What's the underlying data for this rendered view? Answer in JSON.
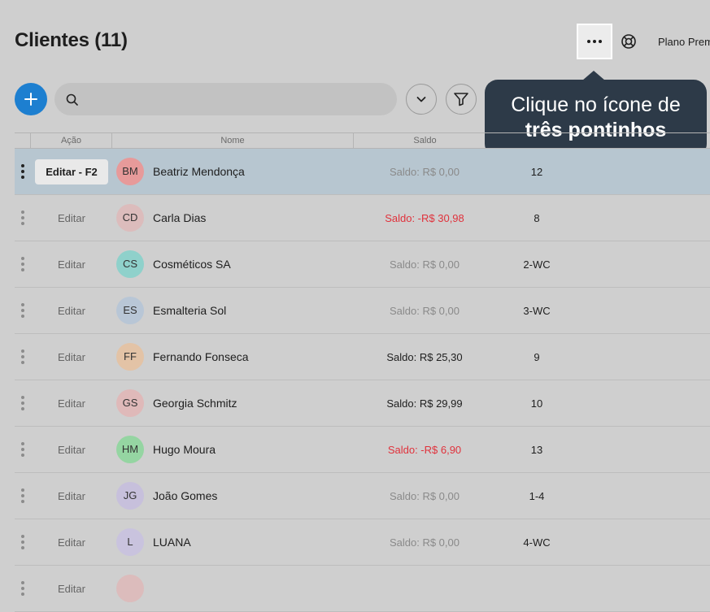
{
  "header": {
    "title": "Clientes (11)",
    "plan_label": "Plano Premium"
  },
  "search": {
    "value": "",
    "placeholder": ""
  },
  "tooltip": {
    "line1": "Clique no ícone de",
    "line2": "três pontinhos"
  },
  "table": {
    "columns": {
      "action": "Ação",
      "name": "Nome",
      "balance": "Saldo"
    },
    "rows": [
      {
        "edit": "Editar - F2",
        "initials": "BM",
        "name": "Beatriz Mendonça",
        "balance": "Saldo: R$ 0,00",
        "balance_status": "zero",
        "code": "12",
        "avatar_color": "#e79a9a",
        "selected": true
      },
      {
        "edit": "Editar",
        "initials": "CD",
        "name": "Carla Dias",
        "balance": "Saldo: -R$ 30,98",
        "balance_status": "neg",
        "code": "8",
        "avatar_color": "#dcbcbc"
      },
      {
        "edit": "Editar",
        "initials": "CS",
        "name": "Cosméticos SA",
        "balance": "Saldo: R$ 0,00",
        "balance_status": "zero",
        "code": "2-WC",
        "avatar_color": "#8fd1cb"
      },
      {
        "edit": "Editar",
        "initials": "ES",
        "name": "Esmalteria Sol",
        "balance": "Saldo: R$ 0,00",
        "balance_status": "zero",
        "code": "3-WC",
        "avatar_color": "#b8c6d6"
      },
      {
        "edit": "Editar",
        "initials": "FF",
        "name": "Fernando Fonseca",
        "balance": "Saldo: R$ 25,30",
        "balance_status": "pos",
        "code": "9",
        "avatar_color": "#e3c3a6"
      },
      {
        "edit": "Editar",
        "initials": "GS",
        "name": "Georgia Schmitz",
        "balance": "Saldo: R$ 29,99",
        "balance_status": "pos",
        "code": "10",
        "avatar_color": "#dfb9b9"
      },
      {
        "edit": "Editar",
        "initials": "HM",
        "name": "Hugo Moura",
        "balance": "Saldo: -R$ 6,90",
        "balance_status": "neg",
        "code": "13",
        "avatar_color": "#95d5a2"
      },
      {
        "edit": "Editar",
        "initials": "JG",
        "name": "João Gomes",
        "balance": "Saldo: R$ 0,00",
        "balance_status": "zero",
        "code": "1-4",
        "avatar_color": "#c7c0dc"
      },
      {
        "edit": "Editar",
        "initials": "L",
        "name": "LUANA",
        "balance": "Saldo: R$ 0,00",
        "balance_status": "zero",
        "code": "4-WC",
        "avatar_color": "#c9c3de"
      },
      {
        "edit": "Editar",
        "initials": "",
        "name": "",
        "balance": "",
        "balance_status": "zero",
        "code": "",
        "avatar_color": "#dcbcbc"
      }
    ]
  },
  "icons": {
    "add": "plus-icon",
    "search": "search-icon",
    "expand": "chevron-down-icon",
    "filter": "filter-icon",
    "more": "more-horizontal-icon",
    "help": "lifebuoy-icon",
    "row_menu": "kebab-vertical-icon"
  },
  "colors": {
    "accent": "#1d7fd0",
    "tooltip_bg": "#2d3a48",
    "negative": "#e0323c",
    "selected_row": "#b7c6d0"
  }
}
